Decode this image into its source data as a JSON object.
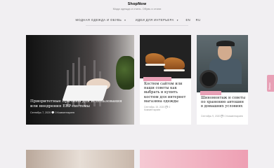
{
  "header": {
    "brand": "ShopNow",
    "tagline": "Мода одежда и стиль. Обувь и стили",
    "nav": [
      {
        "label": "МОДНАЯ ОДЕЖДА И ОБУВЬ",
        "dropdown": true
      },
      {
        "label": "ИДЕИ ДЛЯ ИНТЕРЬЕРА",
        "dropdown": true
      },
      {
        "label": "EN",
        "dropdown": false
      },
      {
        "label": "RU",
        "dropdown": false
      }
    ]
  },
  "posts": {
    "featured": {
      "title": "Приоритетные причины для использования или внедрения ERP-системы",
      "meta": "Сентябрь 7, 2020  💬 0 Комментариев"
    },
    "second": {
      "tag": "",
      "title": "Костюм сайтом или наши советы как выбрать и купить костюм для интернет магазина одежды",
      "meta": "Сентябрь 15, 2020  💬 0 Комментариев"
    },
    "third": {
      "tag": "",
      "title": "Шиномонтаж и советы по хранению автошин в домашних условиях",
      "meta": "Сентябрь 9, 2020  💬 0 Комментариев"
    }
  },
  "side_tab": {
    "label": "Вверх"
  },
  "colors": {
    "accent": "#e8a0b6",
    "background": "#f1eff2"
  }
}
